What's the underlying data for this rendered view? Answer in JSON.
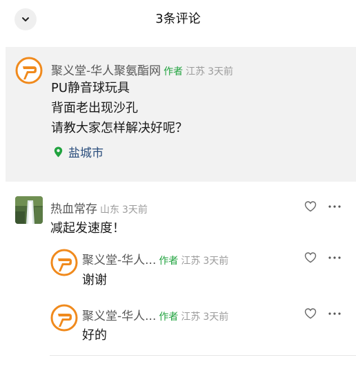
{
  "header": {
    "title": "3条评论",
    "collapse_icon": "chevron-down-icon"
  },
  "post": {
    "author": "聚义堂-华人聚氨酯网",
    "author_tag": "作者",
    "region": "江苏",
    "time": "3天前",
    "lines": [
      "PU静音球玩具",
      "背面老出现沙孔",
      "请教大家怎样解决好呢？"
    ],
    "location": "盐城市"
  },
  "comments": [
    {
      "author": "热血常存",
      "region": "山东",
      "time": "3天前",
      "text": "减起发速度！",
      "replies": [
        {
          "author": "聚义堂-华人...",
          "author_tag": "作者",
          "region": "江苏",
          "time": "3天前",
          "text": "谢谢"
        },
        {
          "author": "聚义堂-华人...",
          "author_tag": "作者",
          "region": "江苏",
          "time": "3天前",
          "text": "好的"
        }
      ]
    }
  ],
  "colors": {
    "author_tag": "#21a33f",
    "location": "#2a4d7c",
    "logo_orange": "#f08a1d",
    "card_bg": "#f2f2f2"
  }
}
